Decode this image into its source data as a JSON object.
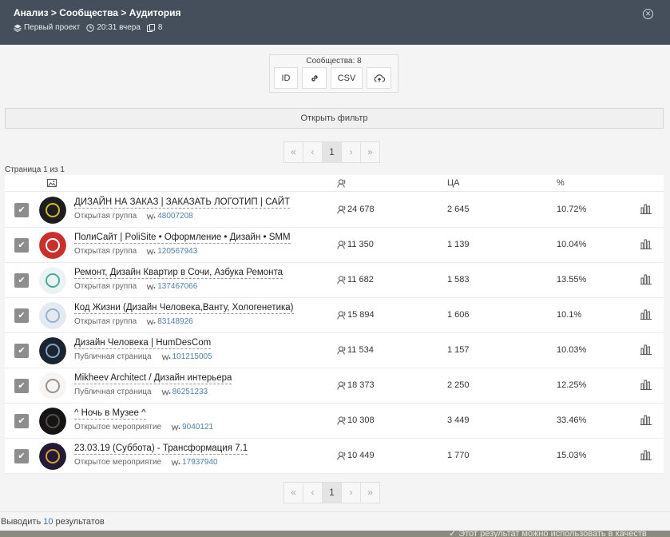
{
  "header": {
    "breadcrumb": "Анализ > Сообщества > Аудитория",
    "project": "Первый проект",
    "time": "20:31 вчера",
    "count": "8"
  },
  "export": {
    "communities_count": "Сообщества: 8",
    "id_label": "ID",
    "csv_label": "CSV"
  },
  "filter": {
    "label": "Открыть фильтр"
  },
  "pager": {
    "first": "«",
    "prev": "‹",
    "current": "1",
    "next": "›",
    "last": "»"
  },
  "page_info": "Страница 1 из 1",
  "table": {
    "col_ca": "ЦА",
    "col_pct": "%",
    "rows": [
      {
        "name": "ДИЗАЙН НА ЗАКАЗ | ЗАКАЗАТЬ ЛОГОТИП | САЙТ",
        "type": "Открытая группа",
        "id": "48007208",
        "members": "24 678",
        "ca": "2 645",
        "pct": "10.72%",
        "avatar_color": "#1d1d1d",
        "avatar_accent": "#d4b82a"
      },
      {
        "name": "ПолиСайт | PoliSite • Оформление • Дизайн • SMM",
        "type": "Открытая группа",
        "id": "120567943",
        "members": "11 350",
        "ca": "1 139",
        "pct": "10.04%",
        "avatar_color": "#c8312b",
        "avatar_accent": "#ffffff"
      },
      {
        "name": "Ремонт, Дизайн Квартир в Сочи, Азбука Ремонта",
        "type": "Открытая группа",
        "id": "137467066",
        "members": "11 682",
        "ca": "1 583",
        "pct": "13.55%",
        "avatar_color": "#e9f4f2",
        "avatar_accent": "#4fa89a"
      },
      {
        "name": "Код Жизни (Дизайн Человека,Ванту, Хологенетика)",
        "type": "Открытая группа",
        "id": "83148926",
        "members": "15 894",
        "ca": "1 606",
        "pct": "10.1%",
        "avatar_color": "#e3eaf2",
        "avatar_accent": "#99b1cc"
      },
      {
        "name": "Дизайн Человека | HumDesCom",
        "type": "Публичная страница",
        "id": "101215005",
        "members": "11 534",
        "ca": "1 157",
        "pct": "10.03%",
        "avatar_color": "#1c2430",
        "avatar_accent": "#7fa3c7"
      },
      {
        "name": "Mikheev Architect / Дизайн интерьера",
        "type": "Публичная страница",
        "id": "86251233",
        "members": "18 373",
        "ca": "2 250",
        "pct": "12.25%",
        "avatar_color": "#f7f5f3",
        "avatar_accent": "#9a9288"
      },
      {
        "name": "^ Ночь в Музее ^",
        "type": "Открытое мероприятие",
        "id": "9040121",
        "members": "10 308",
        "ca": "3 449",
        "pct": "33.46%",
        "avatar_color": "#141414",
        "avatar_accent": "#5a4a44"
      },
      {
        "name": "23.03.19 (Суббота) - Трансформация 7.1",
        "type": "Открытое мероприятие",
        "id": "17937940",
        "members": "10 449",
        "ca": "1 770",
        "pct": "15.03%",
        "avatar_color": "#241a36",
        "avatar_accent": "#d8a232"
      }
    ]
  },
  "footer": {
    "prefix": "Выводить",
    "count": "10",
    "suffix": "результатов"
  },
  "bottom_text": "Этот результат можно использовать в качеств",
  "colors": {
    "header_bg": "#454f5b",
    "link": "#5180a8",
    "checkbox": "#8d8d8d"
  }
}
